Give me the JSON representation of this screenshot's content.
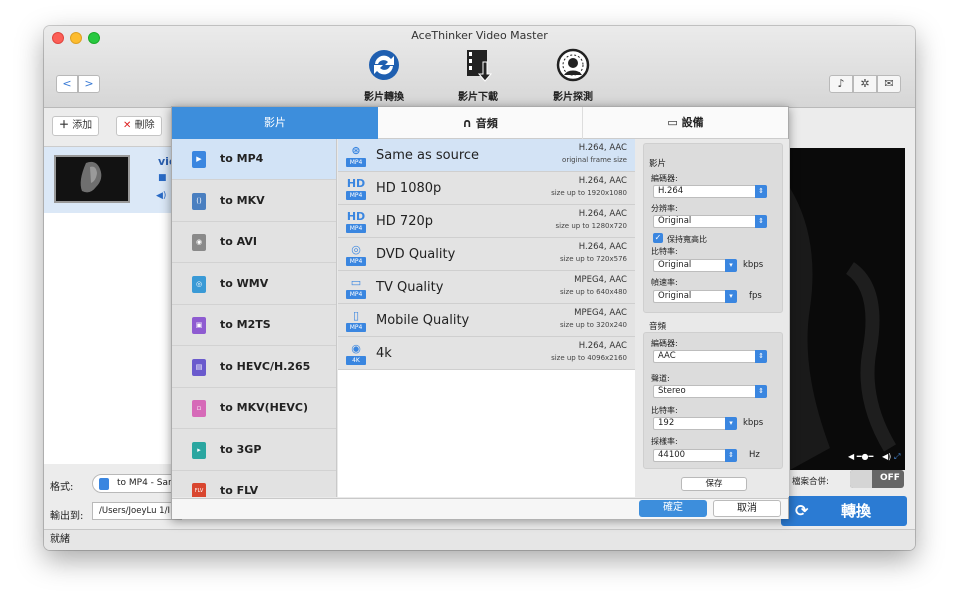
{
  "window": {
    "title": "AceThinker Video Master",
    "nav_back": "<",
    "nav_forward": ">"
  },
  "toolbar": {
    "tools": [
      {
        "label": "影片轉換",
        "icon": "convert-icon"
      },
      {
        "label": "影片下載",
        "icon": "download-icon"
      },
      {
        "label": "影片探測",
        "icon": "detect-icon"
      }
    ],
    "right_icons": [
      "user-icon",
      "gear-icon",
      "feedback-icon"
    ]
  },
  "left": {
    "add_label": "添加",
    "delete_label": "刪除",
    "file_title_snippet": "vic",
    "format_label": "格式:",
    "format_value": "to MP4 - Sar",
    "output_label": "輸出到:",
    "output_value": "/Users/JoeyLu 1/I"
  },
  "status": {
    "text": "就緒"
  },
  "right": {
    "merge_label": "檔案合併:",
    "merge_toggle": "OFF",
    "convert_label": "轉換"
  },
  "dialog": {
    "tabs": [
      {
        "label": "影片",
        "icon": ""
      },
      {
        "label": "音頻",
        "icon": "headphones-icon"
      },
      {
        "label": "設備",
        "icon": "device-icon"
      }
    ],
    "formats": [
      {
        "label": "to MP4",
        "color": "#3a86e0",
        "icon_text": "▶"
      },
      {
        "label": "to MKV",
        "color": "#4a7fc0",
        "icon_text": "()"
      },
      {
        "label": "to AVI",
        "color": "#8a8a8a",
        "icon_text": "◉"
      },
      {
        "label": "to WMV",
        "color": "#3a9ad6",
        "icon_text": "◎"
      },
      {
        "label": "to M2TS",
        "color": "#8e5bd1",
        "icon_text": "▣"
      },
      {
        "label": "to HEVC/H.265",
        "color": "#6a5acd",
        "icon_text": "▤"
      },
      {
        "label": "to MKV(HEVC)",
        "color": "#d66ab8",
        "icon_text": "▫"
      },
      {
        "label": "to 3GP",
        "color": "#2aa6a0",
        "icon_text": "▸"
      },
      {
        "label": "to FLV",
        "color": "#d9462f",
        "icon_text": "FLV"
      }
    ],
    "presets": [
      {
        "name": "Same as source",
        "codec": "H.264, AAC",
        "desc": "original frame size",
        "badge": "MP4"
      },
      {
        "name": "HD 1080p",
        "codec": "H.264, AAC",
        "desc": "size up to 1920x1080",
        "badge": "MP4"
      },
      {
        "name": "HD 720p",
        "codec": "H.264, AAC",
        "desc": "size up to 1280x720",
        "badge": "MP4"
      },
      {
        "name": "DVD Quality",
        "codec": "H.264, AAC",
        "desc": "size up to 720x576",
        "badge": "MP4"
      },
      {
        "name": "TV Quality",
        "codec": "MPEG4, AAC",
        "desc": "size up to 640x480",
        "badge": "MP4"
      },
      {
        "name": "Mobile Quality",
        "codec": "MPEG4, AAC",
        "desc": "size up to 320x240",
        "badge": "MP4"
      },
      {
        "name": "4k",
        "codec": "H.264, AAC",
        "desc": "size up to 4096x2160",
        "badge": "4K"
      }
    ],
    "settings": {
      "video_title": "影片",
      "encoder_label": "編碼器:",
      "encoder_value": "H.264",
      "resolution_label": "分辨率:",
      "resolution_value": "Original",
      "keep_ratio_label": "保持寬高比",
      "bitrate_label": "比特率:",
      "bitrate_value": "Original",
      "bitrate_unit": "kbps",
      "framerate_label": "幀速率:",
      "framerate_value": "Original",
      "framerate_unit": "fps",
      "audio_title": "音頻",
      "a_encoder_label": "編碼器:",
      "a_encoder_value": "AAC",
      "channel_label": "聲道:",
      "channel_value": "Stereo",
      "a_bitrate_label": "比特率:",
      "a_bitrate_value": "192",
      "a_bitrate_unit": "kbps",
      "samplerate_label": "採樣率:",
      "samplerate_value": "44100",
      "samplerate_unit": "Hz",
      "save_label": "保存"
    },
    "ok_label": "確定",
    "cancel_label": "取消"
  },
  "colors": {
    "accent": "#3d8edc",
    "convert_button": "#2b7bd3"
  }
}
